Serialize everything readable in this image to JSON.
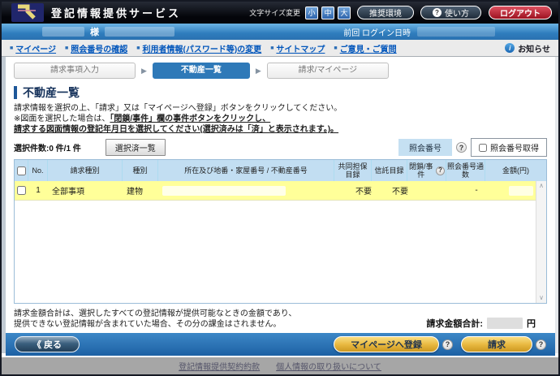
{
  "header": {
    "app_title": "登記情報提供サービス",
    "font_size_label": "文字サイズ変更",
    "font_sizes": [
      "小",
      "中",
      "大"
    ],
    "env_button": "推奨環境",
    "help_button": "使い方",
    "logout_button": "ログアウト"
  },
  "user_bar": {
    "name_suffix": "様",
    "last_login_label": "前回 ログイン日時"
  },
  "nav": {
    "items": [
      {
        "label": "マイページ"
      },
      {
        "label": "照会番号の確認"
      },
      {
        "label": "利用者情報(パスワード等)の変更"
      },
      {
        "label": "サイトマップ"
      },
      {
        "label": "ご意見・ご質問"
      }
    ],
    "notice_label": "お知らせ"
  },
  "steps": {
    "step1": "請求事項入力",
    "step2": "不動産一覧",
    "step3": "請求/マイページ"
  },
  "page": {
    "title": "不動産一覧",
    "instruction1": "請求情報を選択の上、「請求」又は「マイページへ登録」ボタンをクリックしてください。",
    "instruction2_prefix": "※図面を選択した場合は、",
    "instruction2_bold": "「閉鎖/事件」欄の事件ボタンをクリックし、",
    "instruction3_bold": "請求する図面情報の登記年月日を選択してください(選択済みは「済」と表示されます。)。",
    "selected_count_label": "選択件数:0 件/1 件",
    "selected_list_button": "選択済一覧",
    "shokai_label": "照会番号",
    "shokai_checkbox_label": "照会番号取得"
  },
  "table": {
    "headers": {
      "no": "No.",
      "request_type": "請求種別",
      "type": "種別",
      "address": "所在及び地番・家屋番号 / 不動産番号",
      "kyodo": "共同担保目録",
      "shintaku": "信託目録",
      "heisa": "閉鎖/事件",
      "tsusu": "照会番号通数",
      "amount": "金額(円)"
    },
    "row": {
      "no": "1",
      "request_type": "全部事項",
      "type": "建物",
      "kyodo": "不要",
      "shintaku": "不要",
      "tsusu": "-"
    }
  },
  "summary": {
    "note1": "請求金額合計は、選択したすべての登記情報が提供可能なときの金額であり、",
    "note2": "提供できない登記情報が含まれていた場合、その分の課金はされません。",
    "total_label": "請求金額合計:",
    "total_unit": "円"
  },
  "actions": {
    "back_button": "《 戻る",
    "mypage_button": "マイページへ登録",
    "request_button": "請求"
  },
  "footer": {
    "links": [
      {
        "label": "登記情報提供契約約款"
      },
      {
        "label": "個人情報の取り扱いについて"
      }
    ]
  },
  "icons": {
    "step_arrow": "▶",
    "question": "?",
    "info": "i",
    "bullet": "■",
    "scroll_up": "∧",
    "scroll_down": "∨"
  },
  "colors": {
    "accent_blue": "#2e79b8",
    "bar_blue": "#2f7dbd",
    "header_blue": "#c2def2",
    "row_yellow": "#ffff99",
    "gold": "#e9ba42",
    "logout_red": "#9d1220"
  }
}
